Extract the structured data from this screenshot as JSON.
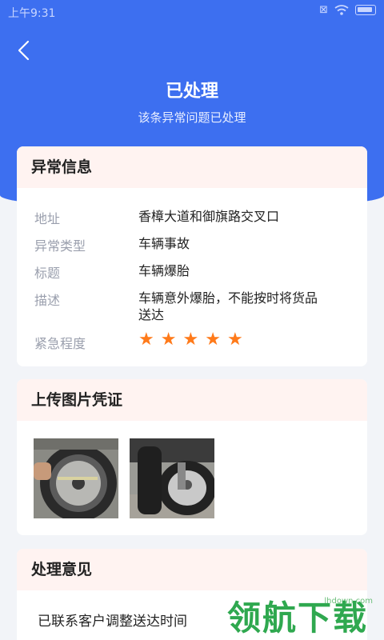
{
  "status_bar": {
    "time": "上午9:31"
  },
  "header": {
    "title": "已处理",
    "subtitle": "该条异常问题已处理"
  },
  "info_card": {
    "title": "异常信息",
    "rows": [
      {
        "label": "地址",
        "value": "香樟大道和御旗路交叉口"
      },
      {
        "label": "异常类型",
        "value": "车辆事故"
      },
      {
        "label": "标题",
        "value": "车辆爆胎"
      },
      {
        "label": "描述",
        "value": "车辆意外爆胎，不能按时将货品送达"
      },
      {
        "label": "紧急程度",
        "stars": 5
      }
    ]
  },
  "photo_card": {
    "title": "上传图片凭证",
    "photos": [
      "tire-photo-1",
      "tire-photo-2"
    ]
  },
  "opinion_card": {
    "title": "处理意见",
    "text": "已联系客户调整送达时间"
  },
  "watermark": {
    "url": "lhdown.com",
    "text": "领航下载"
  },
  "colors": {
    "primary": "#3d6ff0",
    "star": "#ff7a1a",
    "card_header_bg": "#fff3f1"
  }
}
